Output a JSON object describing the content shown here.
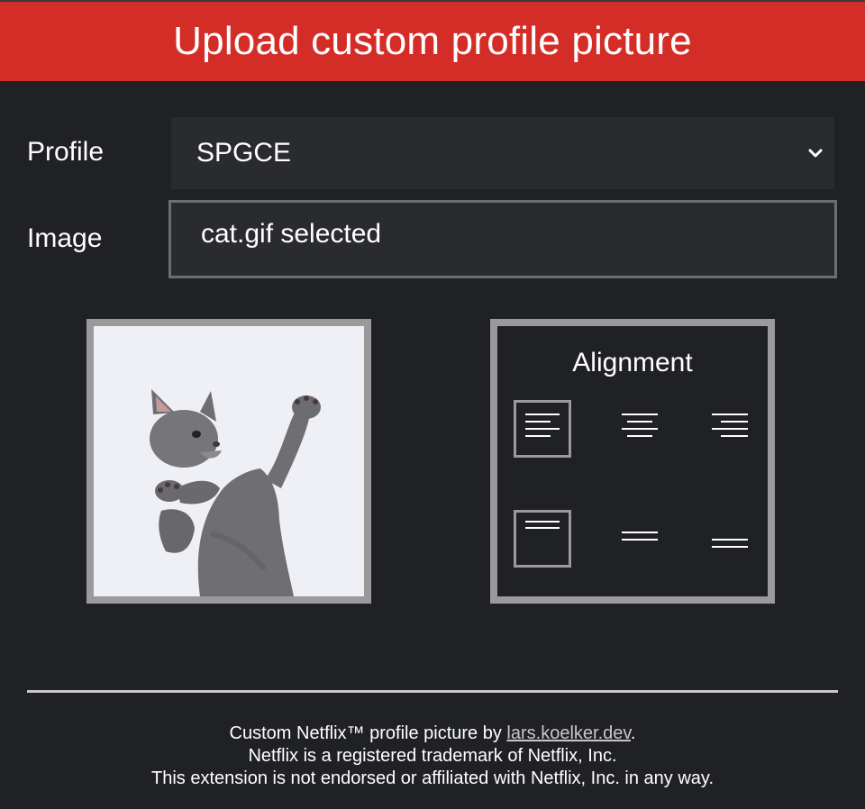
{
  "header": {
    "title": "Upload custom profile picture"
  },
  "profile": {
    "label": "Profile",
    "selected": "SPGCE"
  },
  "image": {
    "label": "Image",
    "status": "cat.gif selected"
  },
  "preview": {
    "subject": "cat"
  },
  "alignment": {
    "title": "Alignment",
    "options": [
      {
        "name": "top-left",
        "selected": true
      },
      {
        "name": "top-center",
        "selected": false
      },
      {
        "name": "top-right",
        "selected": false
      },
      {
        "name": "middle-top",
        "selected": true
      },
      {
        "name": "middle-center",
        "selected": false
      },
      {
        "name": "middle-bottom",
        "selected": false
      }
    ]
  },
  "footer": {
    "line1_prefix": "Custom Netflix™ profile picture by ",
    "line1_link": "lars.koelker.dev",
    "line1_suffix": ".",
    "line2": "Netflix is a registered trademark of Netflix, Inc.",
    "line3": "This extension is not endorsed or affiliated with Netflix, Inc. in any way."
  },
  "colors": {
    "header_bg": "#d42d27",
    "page_bg": "#202124",
    "panel_border": "#9a9a9a"
  }
}
